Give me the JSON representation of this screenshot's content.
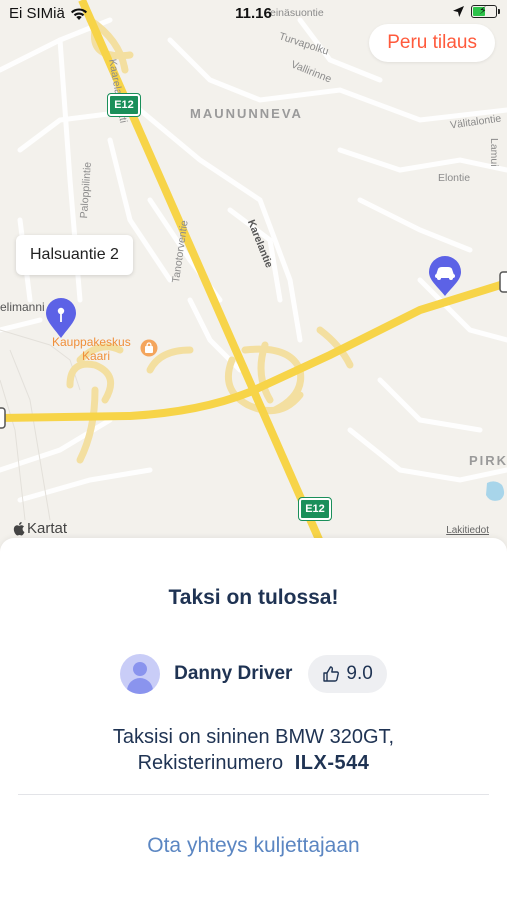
{
  "status_bar": {
    "carrier": "Ei SIMiä",
    "time": "11.16",
    "battery_color": "#2ec34b"
  },
  "map": {
    "cancel_label": "Peru tilaus",
    "district_labels": [
      "MAUNUNNEVA",
      "PIRK"
    ],
    "street_labels": [
      "Kaarelan raitti",
      "Turvapolku",
      "Vallirinne",
      "Välitalontie",
      "Elontie",
      "Karelantie",
      "Tanotorventie",
      "Paloppilintie",
      "elimanni",
      "Lamui",
      "einäsuontie"
    ],
    "route_shields": [
      "E12",
      "E12"
    ],
    "poi": {
      "name_line1": "Kauppakeskus",
      "name_line2": "Kaari"
    },
    "pickup_callout": "Halsuantie 2",
    "attribution": "Kartat",
    "legal_label": "Lakitiedot",
    "icons": [
      "location-arrow-icon",
      "pickup-pin-icon",
      "taxi-car-icon",
      "shopping-bag-icon",
      "apple-logo-icon"
    ],
    "colors": {
      "road_major": "#f7d448",
      "road_ramp": "#f3dfa0",
      "pickup_pin": "#5c62e6",
      "cancel_text": "#ff5a3c",
      "shield": "#1a8f5a"
    }
  },
  "sheet": {
    "title": "Taksi on tulossa!",
    "driver_name": "Danny Driver",
    "rating": "9.0",
    "car_line1": "Taksisi on sininen BMW 320GT,",
    "car_line2_prefix": "Rekisterinumero",
    "plate": "ILX-544",
    "contact_label": "Ota yhteys kuljettajaan",
    "colors": {
      "text_primary": "#1f3353",
      "link": "#5b86c2",
      "avatar_bg": "#c9cdf7"
    }
  }
}
